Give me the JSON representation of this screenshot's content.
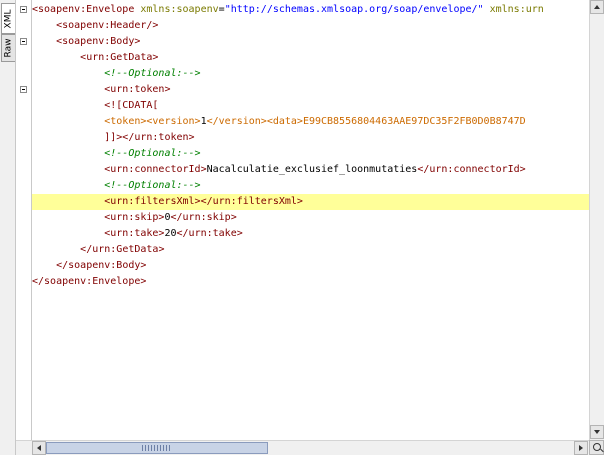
{
  "tabs": {
    "xml": "XML",
    "raw": "Raw"
  },
  "highlight_color": "#ffff99",
  "lines": [
    [
      {
        "c": "t",
        "s": "<soapenv:Envelope "
      },
      {
        "c": "a",
        "s": "xmlns:soapenv"
      },
      {
        "c": "x",
        "s": "="
      },
      {
        "c": "v",
        "s": "\"http://schemas.xmlsoap.org/soap/envelope/\""
      },
      {
        "c": "a",
        "s": " xmlns:urn"
      }
    ],
    [
      {
        "c": "x",
        "s": "    "
      },
      {
        "c": "t",
        "s": "<soapenv:Header/>"
      }
    ],
    [
      {
        "c": "x",
        "s": "    "
      },
      {
        "c": "t",
        "s": "<soapenv:Body>"
      }
    ],
    [
      {
        "c": "x",
        "s": "        "
      },
      {
        "c": "t",
        "s": "<urn:GetData>"
      }
    ],
    [
      {
        "c": "x",
        "s": "            "
      },
      {
        "c": "c",
        "s": "<!--Optional:-->"
      }
    ],
    [
      {
        "c": "x",
        "s": "            "
      },
      {
        "c": "t",
        "s": "<urn:token>"
      }
    ],
    [
      {
        "c": "x",
        "s": "            "
      },
      {
        "c": "t",
        "s": "<![CDATA["
      }
    ],
    [
      {
        "c": "x",
        "s": "            "
      },
      {
        "c": "ic",
        "s": "<token><version>"
      },
      {
        "c": "cd",
        "s": "1"
      },
      {
        "c": "ic",
        "s": "</version><data>"
      },
      {
        "c": "ic",
        "s": "E99CB8556804463AAE97DC35F2FB0D0B8747D"
      }
    ],
    [
      {
        "c": "x",
        "s": "            "
      },
      {
        "c": "t",
        "s": "]]></urn:token>"
      }
    ],
    [
      {
        "c": "x",
        "s": "            "
      },
      {
        "c": "c",
        "s": "<!--Optional:-->"
      }
    ],
    [
      {
        "c": "x",
        "s": "            "
      },
      {
        "c": "t",
        "s": "<urn:connectorId>"
      },
      {
        "c": "cd",
        "s": "Nacalculatie_exclusief_loonmutaties"
      },
      {
        "c": "t",
        "s": "</urn:connectorId>"
      }
    ],
    [
      {
        "c": "x",
        "s": "            "
      },
      {
        "c": "c",
        "s": "<!--Optional:-->"
      }
    ],
    [
      {
        "c": "x",
        "s": "            "
      },
      {
        "c": "t",
        "s": "<urn:filtersXml></urn:filtersXml>"
      }
    ],
    [
      {
        "c": "x",
        "s": "            "
      },
      {
        "c": "t",
        "s": "<urn:skip>"
      },
      {
        "c": "cd",
        "s": "0"
      },
      {
        "c": "t",
        "s": "</urn:skip>"
      }
    ],
    [
      {
        "c": "x",
        "s": "            "
      },
      {
        "c": "t",
        "s": "<urn:take>"
      },
      {
        "c": "cd",
        "s": "20"
      },
      {
        "c": "t",
        "s": "</urn:take>"
      }
    ],
    [
      {
        "c": "x",
        "s": "        "
      },
      {
        "c": "t",
        "s": "</urn:GetData>"
      }
    ],
    [
      {
        "c": "x",
        "s": "    "
      },
      {
        "c": "t",
        "s": "</soapenv:Body>"
      }
    ],
    [
      {
        "c": "t",
        "s": "</soapenv:Envelope>"
      }
    ]
  ],
  "highlighted_line": 12,
  "fold_lines": [
    0,
    2,
    5
  ]
}
